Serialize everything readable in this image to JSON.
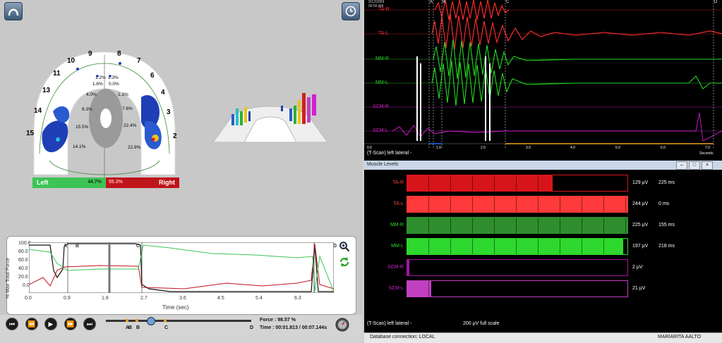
{
  "left_panel": {
    "teeth_numbers": [
      "10",
      "9",
      "8",
      "7",
      "11",
      "6",
      "13",
      "4",
      "14",
      "3",
      "15",
      "2"
    ],
    "percentages": [
      "1.2%",
      "1.3%",
      "1.6%",
      "0.0%",
      "4.0%",
      "1.1%",
      "8.3%",
      "7.6%",
      "15.5%",
      "22.4%",
      "14.1%",
      "22.9%"
    ],
    "legend_left_label": "Left",
    "legend_left_value": "44.7%",
    "legend_right_value": "55.3%",
    "legend_right_label": "Right",
    "colors": {
      "left": "#3cc456",
      "right": "#c0141b"
    }
  },
  "graph": {
    "ylabel": "% Max Total Force",
    "xlabel": "Time (sec)",
    "yticks": [
      "100.0",
      "80.0",
      "60.0",
      "40.0",
      "20.0",
      "0.0"
    ],
    "xticks": [
      "0.0",
      "0.9",
      "1.8",
      "2.7",
      "3.6",
      "4.5",
      "5.4",
      "6.3"
    ],
    "markers": [
      "A",
      "B",
      "C",
      "D"
    ]
  },
  "player": {
    "force_text": "Force : 98.57 %",
    "time_text": "Time : 00:01.813 / 00:07.144s",
    "slider_markers": [
      "A",
      "B",
      "B",
      "C",
      "D"
    ]
  },
  "emg": {
    "date": "9/12/2009",
    "time": "09:56 AM",
    "channels": [
      "TA-R",
      "TA-L",
      "MM-R",
      "MM-L",
      "SCM-R",
      "SCM-L"
    ],
    "markers": [
      "A",
      "B",
      "C",
      "D"
    ],
    "footer_label": "(T-Scan) left lateral -",
    "xticks": [
      "0.0",
      "1.0",
      "2.0",
      "3.0",
      "4.0",
      "5.0",
      "6.0",
      "7.0"
    ],
    "xunit": "Seconds"
  },
  "muscle_levels": {
    "window_title": "Muscle Levels",
    "rows": [
      {
        "label": "TA-R",
        "value": "129 µV",
        "ms": "225 ms",
        "level": 0.66
      },
      {
        "label": "TA-L",
        "value": "244 µV",
        "ms": "0 ms",
        "level": 1.0
      },
      {
        "label": "MM-R",
        "value": "225 µV",
        "ms": "155 ms",
        "level": 1.0
      },
      {
        "label": "MM-L",
        "value": "197 µV",
        "ms": "218 ms",
        "level": 0.98
      },
      {
        "label": "SCM-R",
        "value": "2 µV",
        "ms": "",
        "level": 0.01
      },
      {
        "label": "SCM-L",
        "value": "21 µV",
        "ms": "",
        "level": 0.11
      }
    ],
    "footer_label": "(T-Scan) left lateral -",
    "scale_label": "200 µV full scale"
  },
  "status_bar": {
    "db": "Database connection: LOCAL",
    "user": "MARIARITA AALTO"
  }
}
